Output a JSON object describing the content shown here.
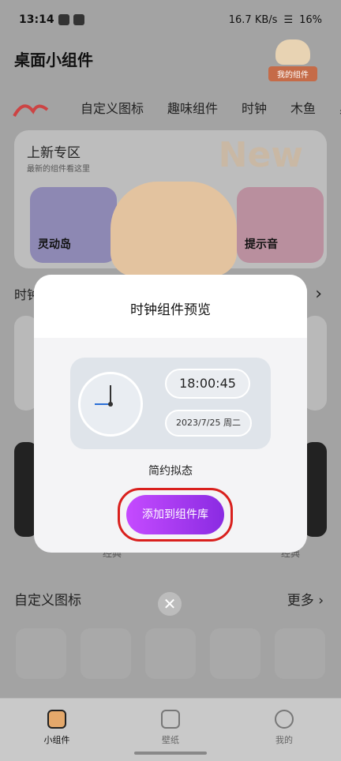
{
  "status_bar": {
    "time": "13:14",
    "network_speed": "16.7 KB/s",
    "battery": "16%"
  },
  "header": {
    "title": "桌面小组件",
    "my_widgets_label": "我的组件"
  },
  "tabs": [
    {
      "label": "自定义图标"
    },
    {
      "label": "趣味组件"
    },
    {
      "label": "时钟"
    },
    {
      "label": "木鱼"
    },
    {
      "label": "桌"
    }
  ],
  "new_zone": {
    "title": "上新专区",
    "subtitle": "最新的组件看这里",
    "watermark": "New",
    "cards": [
      {
        "label": "灵动岛"
      },
      {
        "label": "提示音"
      }
    ]
  },
  "clock_section": {
    "label_partial": "时钟"
  },
  "background_labels": {
    "classic_left": "经典",
    "classic_right": "经典"
  },
  "custom_icons": {
    "title": "自定义图标",
    "more": "更多"
  },
  "modal": {
    "title": "时钟组件预览",
    "digital_time": "18:00:45",
    "date": "2023/7/25 周二",
    "style_name": "简约拟态",
    "add_button": "添加到组件库"
  },
  "bottom_nav": [
    {
      "label": "小组件",
      "active": true
    },
    {
      "label": "壁纸",
      "active": false
    },
    {
      "label": "我的",
      "active": false
    }
  ]
}
